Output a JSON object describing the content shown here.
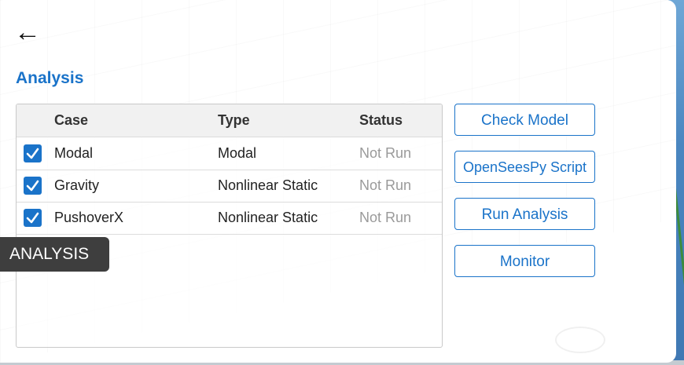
{
  "header": {
    "back_icon": "←",
    "title": "Analysis"
  },
  "table": {
    "columns": [
      "Case",
      "Type",
      "Status"
    ],
    "rows": [
      {
        "checked": true,
        "case": "Modal",
        "type": "Modal",
        "status": "Not Run"
      },
      {
        "checked": true,
        "case": "Gravity",
        "type": "Nonlinear Static",
        "status": "Not Run"
      },
      {
        "checked": true,
        "case": "PushoverX",
        "type": "Nonlinear Static",
        "status": "Not Run"
      }
    ]
  },
  "actions": {
    "check_model": "Check Model",
    "opensees_script": "OpenSeesPy Script",
    "run_analysis": "Run Analysis",
    "monitor": "Monitor"
  },
  "tooltip": {
    "text": "ANALYSIS"
  },
  "colors": {
    "accent": "#1a73c9",
    "status_gray": "#9a9a9a",
    "tooltip_bg": "#3e3e3e"
  },
  "icons": {
    "back": "arrow-left-icon",
    "check": "checkbox-check-icon"
  }
}
